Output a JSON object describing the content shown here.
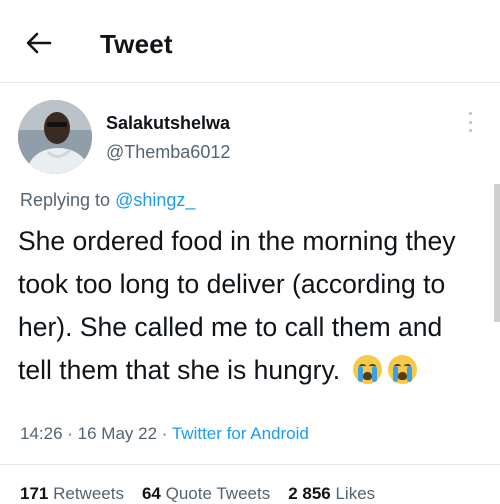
{
  "header": {
    "title": "Tweet",
    "back_icon": "arrow-left-icon"
  },
  "author": {
    "name": "Salakutshelwa",
    "handle": "@Themba6012"
  },
  "reply": {
    "prefix": "Replying to ",
    "mention": "@shingz_"
  },
  "tweet": {
    "text": "She ordered food in the morning they took too long to deliver (according to her). She called me to call them and tell them that she is hungry.",
    "emojis": [
      "loudly-crying-face",
      "loudly-crying-face"
    ]
  },
  "meta": {
    "time": "14:26",
    "date": "16 May 22",
    "separator": " · ",
    "source": "Twitter for Android"
  },
  "stats": {
    "retweets_count": "171",
    "retweets_label": " Retweets",
    "quotes_count": "64",
    "quotes_label": " Quote Tweets",
    "likes_count": "2 856",
    "likes_label": " Likes"
  },
  "colors": {
    "accent": "#1d9bf0",
    "secondary_text": "#536471",
    "primary_text": "#0f1419"
  }
}
